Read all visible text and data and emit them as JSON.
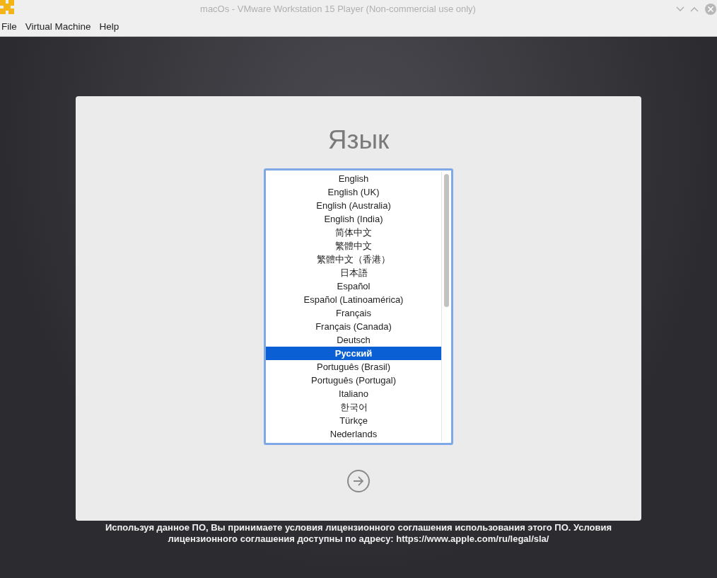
{
  "window": {
    "title": "macOs - VMware Workstation 15 Player (Non-commercial use only)"
  },
  "menu": [
    "File",
    "Virtual Machine",
    "Help"
  ],
  "installer": {
    "heading": "Язык",
    "languages": [
      {
        "label": "English",
        "selected": false
      },
      {
        "label": "English (UK)",
        "selected": false
      },
      {
        "label": "English (Australia)",
        "selected": false
      },
      {
        "label": "English (India)",
        "selected": false
      },
      {
        "label": "简体中文",
        "selected": false
      },
      {
        "label": "繁體中文",
        "selected": false
      },
      {
        "label": "繁體中文（香港）",
        "selected": false
      },
      {
        "label": "日本語",
        "selected": false
      },
      {
        "label": "Español",
        "selected": false
      },
      {
        "label": "Español (Latinoamérica)",
        "selected": false
      },
      {
        "label": "Français",
        "selected": false
      },
      {
        "label": "Français (Canada)",
        "selected": false
      },
      {
        "label": "Deutsch",
        "selected": false
      },
      {
        "label": "Русский",
        "selected": true
      },
      {
        "label": "Português (Brasil)",
        "selected": false
      },
      {
        "label": "Português (Portugal)",
        "selected": false
      },
      {
        "label": "Italiano",
        "selected": false
      },
      {
        "label": "한국어",
        "selected": false
      },
      {
        "label": "Türkçe",
        "selected": false
      },
      {
        "label": "Nederlands",
        "selected": false
      }
    ],
    "license": "Используя данное ПО, Вы принимаете условия лицензионного соглашения использования этого ПО. Условия лицензионного соглашения доступны по адресу: https://www.apple.com/ru/legal/sla/"
  }
}
